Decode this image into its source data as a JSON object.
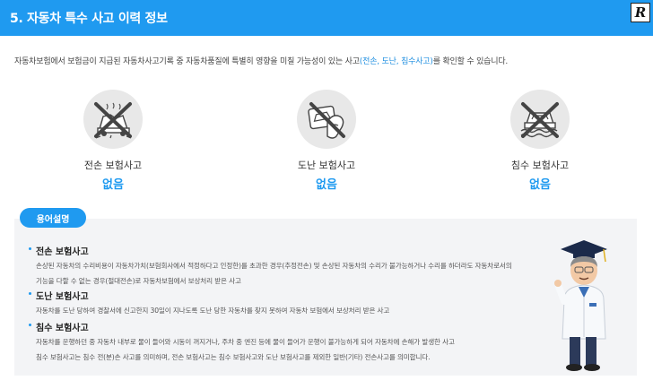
{
  "header": {
    "title": "5. 자동차 특수 사고 이력 정보",
    "logo_letter": "R"
  },
  "intro": {
    "before": "자동차보험에서 보험금이 지급된 자동차사고기록 중 자동차품질에 특별히 영향을 미칠 가능성이 있는 사고",
    "highlight": "(전손, 도난, 침수사고)",
    "after": "를 확인할 수 있습니다."
  },
  "accidents": [
    {
      "name": "전손 보험사고",
      "value": "없음",
      "icon": "wrecked-car-icon"
    },
    {
      "name": "도난 보험사고",
      "value": "없음",
      "icon": "theft-hand-car-icon"
    },
    {
      "name": "침수 보험사고",
      "value": "없음",
      "icon": "flooded-car-icon"
    }
  ],
  "glossary": {
    "tag": "용어설명",
    "terms": [
      {
        "title": "전손 보험사고",
        "line1": "손상된 자동차의 수리비용이 자동차가치(보험회사에서 적정하다고 인정한)를 초과한 경우(추정전손) 및 손상된 자동차의 수리가 불가능하거나 수리를 하더라도 자동차로서의",
        "line2": "기능을 다할 수 없는 경우(절대전손)로 자동차보험에서 보상처리 받은 사고"
      },
      {
        "title": "도난 보험사고",
        "line1": "자동차를 도난 당하여 경찰서에 신고한지 30일이 지나도록 도난 당한 자동차를 찾지 못하여 자동차 보험에서 보상처리 받은 사고",
        "line2": ""
      },
      {
        "title": "침수 보험사고",
        "line1": "자동차를 운행하던 중 자동차 내부로 물이 들어와 시동이 꺼지거나, 주차 중 엔진 등에 물이 들어가 운행이 불가능하게 되어 자동차에 손해가 발생한 사고",
        "line2": "침수 보험사고는 침수 전(분)손 사고를 의미하며, 전손 보험사고는 침수 보험사고와 도난 보험사고를 제외한 일반(기타) 전손사고를 의미합니다."
      }
    ]
  },
  "colors": {
    "accent": "#1f9af0",
    "panel": "#f3f4f6",
    "icon_bg": "#e8e8e8"
  }
}
